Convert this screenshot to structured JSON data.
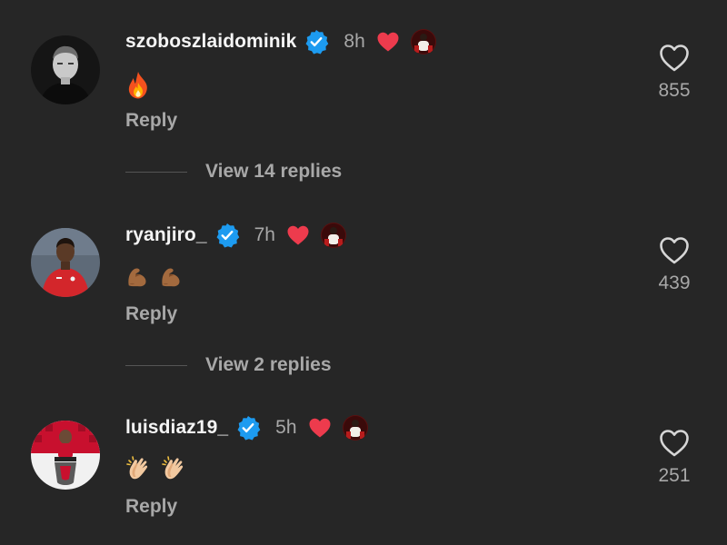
{
  "colors": {
    "background": "#262626",
    "verified_blue": "#1d9bf0",
    "liked_heart": "#ed3b4d",
    "secondary_text": "#a8a8a8"
  },
  "comments": [
    {
      "username": "szoboszlaidominik",
      "time": "8h",
      "text_emoji": "fire",
      "reply_label": "Reply",
      "view_replies": "View 14 replies",
      "likes": "855"
    },
    {
      "username": "ryanjiro_",
      "time": "7h",
      "text_emoji": "flexed-biceps x2",
      "reply_label": "Reply",
      "view_replies": "View 2 replies",
      "likes": "439"
    },
    {
      "username": "luisdiaz19_",
      "time": "5h",
      "text_emoji": "clapping-hands x2",
      "reply_label": "Reply",
      "likes": "251"
    }
  ]
}
